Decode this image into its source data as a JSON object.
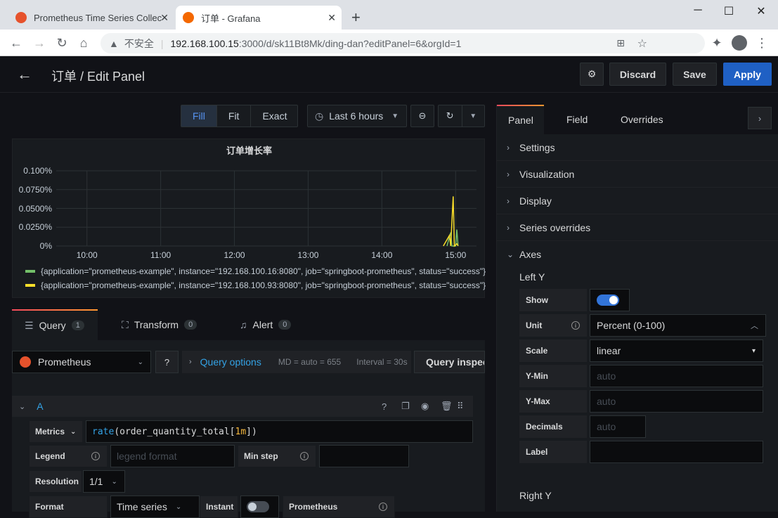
{
  "browser": {
    "tabs": [
      {
        "title": "Prometheus Time Series Collec"
      },
      {
        "title": "订单 - Grafana"
      }
    ],
    "close_glyph": "✕",
    "new_tab_glyph": "+",
    "address": {
      "insecure_label": "不安全",
      "host": "192.168.100.15",
      "path": ":3000/d/sk11Bt8Mk/ding-dan?editPanel=6&orgId=1"
    }
  },
  "header": {
    "title": "订单 / Edit Panel",
    "discard": "Discard",
    "save": "Save",
    "apply": "Apply"
  },
  "toolbar": {
    "fill": "Fill",
    "fit": "Fit",
    "exact": "Exact",
    "time_range": "Last 6 hours"
  },
  "chart_data": {
    "type": "line",
    "title": "订单增长率",
    "y_ticks": [
      "0.100%",
      "0.0750%",
      "0.0500%",
      "0.0250%",
      "0%"
    ],
    "x_ticks": [
      "10:00",
      "11:00",
      "12:00",
      "13:00",
      "14:00",
      "15:00"
    ],
    "ylim": [
      0,
      0.1
    ],
    "grid": true,
    "legend_placement": "bottom",
    "series": [
      {
        "name": "{application=\"prometheus-example\", instance=\"192.168.100.16:8080\", job=\"springboot-prometheus\", status=\"success\"}",
        "color": "#73bf69",
        "points": [
          [
            "14:53",
            0
          ],
          [
            "14:56",
            0.018
          ],
          [
            "14:57",
            0
          ],
          [
            "15:00",
            0
          ],
          [
            "15:01",
            0.022
          ],
          [
            "15:02",
            0
          ]
        ]
      },
      {
        "name": "{application=\"prometheus-example\", instance=\"192.168.100.93:8080\", job=\"springboot-prometheus\", status=\"success\"}",
        "color": "#fade2a",
        "points": [
          [
            "14:50",
            0
          ],
          [
            "14:55",
            0.014
          ],
          [
            "14:56",
            0
          ],
          [
            "14:58",
            0.066
          ],
          [
            "14:59",
            0
          ],
          [
            "15:01",
            0.003
          ],
          [
            "15:02",
            0
          ]
        ]
      }
    ]
  },
  "query_tabs": [
    {
      "label": "Query",
      "count": "1"
    },
    {
      "label": "Transform",
      "count": "0"
    },
    {
      "label": "Alert",
      "count": "0"
    }
  ],
  "query": {
    "datasource": "Prometheus",
    "options_label": "Query options",
    "md": "MD = auto = 655",
    "interval": "Interval = 30s",
    "inspector": "Query inspector",
    "ref": "A",
    "metrics_label": "Metrics",
    "expr_fn": "rate",
    "expr_metric": "order_quantity_total",
    "expr_range": "1m",
    "legend_label": "Legend",
    "legend_placeholder": "legend format",
    "minstep_label": "Min step",
    "resolution_label": "Resolution",
    "resolution_value": "1/1",
    "format_label": "Format",
    "format_value": "Time series",
    "instant_label": "Instant",
    "prom_label": "Prometheus"
  },
  "right": {
    "tabs": [
      "Panel",
      "Field",
      "Overrides"
    ],
    "sections": [
      "Settings",
      "Visualization",
      "Display",
      "Series overrides",
      "Axes"
    ],
    "left_y": "Left Y",
    "show": "Show",
    "unit": "Unit",
    "unit_value": "Percent (0-100)",
    "scale": "Scale",
    "scale_value": "linear",
    "ymin": "Y-Min",
    "ymax": "Y-Max",
    "decimals": "Decimals",
    "label": "Label",
    "auto": "auto",
    "right_y": "Right Y"
  }
}
